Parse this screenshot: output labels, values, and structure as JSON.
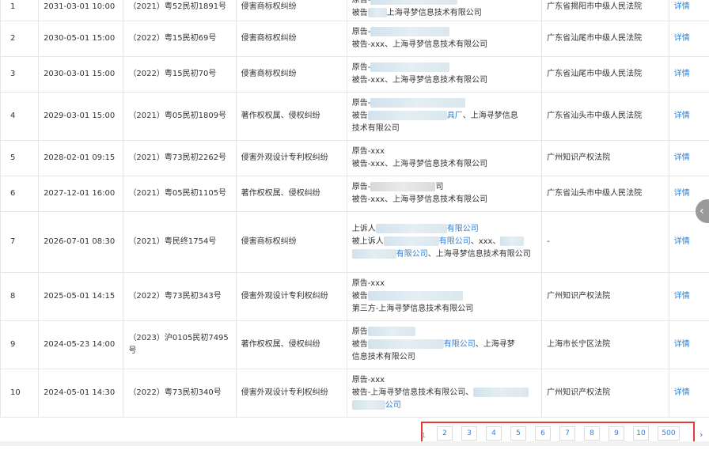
{
  "detail_label": "详情",
  "rows": [
    {
      "idx": "1",
      "date": "2031-03-01 10:00",
      "case": "（2021）粤52民初1891号",
      "cause": "侵害商标权纠纷",
      "party": [
        [
          {
            "t": "原告-"
          },
          {
            "b": 110
          }
        ],
        [
          {
            "t": "被告"
          },
          {
            "b": 24
          },
          {
            "t": "上海寻梦信息技术有限公司"
          }
        ]
      ],
      "court": "广东省揭阳市中级人民法院"
    },
    {
      "idx": "2",
      "date": "2030-05-01 15:00",
      "case": "（2022）粤15民初69号",
      "cause": "侵害商标权纠纷",
      "party": [
        [
          {
            "t": "原告-"
          },
          {
            "b": 100
          }
        ],
        [
          {
            "t": "被告-xxx、上海寻梦信息技术有限公司"
          }
        ]
      ],
      "court": "广东省汕尾市中级人民法院"
    },
    {
      "idx": "3",
      "date": "2030-03-01 15:00",
      "case": "（2022）粤15民初70号",
      "cause": "侵害商标权纠纷",
      "party": [
        [
          {
            "t": "原告-"
          },
          {
            "b": 100
          }
        ],
        [
          {
            "t": "被告-xxx、上海寻梦信息技术有限公司"
          }
        ]
      ],
      "court": "广东省汕尾市中级人民法院"
    },
    {
      "idx": "4",
      "date": "2029-03-01 15:00",
      "case": "（2021）粤05民初1809号",
      "cause": "著作权权属、侵权纠纷",
      "party": [
        [
          {
            "t": "原告-"
          },
          {
            "b": 120
          }
        ],
        [
          {
            "t": "被告"
          },
          {
            "b": 100
          },
          {
            "t": "具厂",
            "c": "blue"
          },
          {
            "t": "、上海寻梦信息"
          }
        ],
        [
          {
            "t": "技术有限公司"
          }
        ]
      ],
      "court": "广东省汕头市中级人民法院"
    },
    {
      "idx": "5",
      "date": "2028-02-01 09:15",
      "case": "（2021）粤73民初2262号",
      "cause": "侵害外观设计专利权纠纷",
      "party": [
        [
          {
            "t": "原告-xxx"
          }
        ],
        [
          {
            "t": "被告-xxx、上海寻梦信息技术有限公司"
          }
        ]
      ],
      "court": "广州知识产权法院"
    },
    {
      "idx": "6",
      "date": "2027-12-01 16:00",
      "case": "（2021）粤05民初1105号",
      "cause": "著作权权属、侵权纠纷",
      "party": [
        [
          {
            "t": "原告-"
          },
          {
            "b": 82,
            "g": 1
          },
          {
            "t": "司"
          }
        ],
        [
          {
            "t": "被告-xxx、上海寻梦信息技术有限公司"
          }
        ]
      ],
      "court": "广东省汕头市中级人民法院"
    },
    {
      "idx": "7",
      "date": "2026-07-01 08:30",
      "case": "（2021）粤民终1754号",
      "cause": "侵害商标权纠纷",
      "party": [
        [
          {
            "t": "上诉人"
          },
          {
            "b": 90
          },
          {
            "t": "有限公司",
            "c": "blue"
          }
        ],
        [
          {
            "t": "被上诉人"
          },
          {
            "b": 70
          },
          {
            "t": "有限公司",
            "c": "blue"
          },
          {
            "t": "、xxx、"
          },
          {
            "b": 30
          }
        ],
        [
          {
            "b": 56
          },
          {
            "t": "有限公司",
            "c": "blue"
          },
          {
            "t": "、上海寻梦信息技术有限公司"
          }
        ]
      ],
      "court": "-"
    },
    {
      "idx": "8",
      "date": "2025-05-01 14:15",
      "case": "（2022）粤73民初343号",
      "cause": "侵害外观设计专利权纠纷",
      "party": [
        [
          {
            "t": "原告-xxx"
          }
        ],
        [
          {
            "t": "被告"
          },
          {
            "b": 120
          }
        ],
        [
          {
            "t": "第三方-上海寻梦信息技术有限公司"
          }
        ]
      ],
      "court": "广州知识产权法院"
    },
    {
      "idx": "9",
      "date": "2024-05-23 14:00",
      "case": "（2023）沪0105民初7495号",
      "cause": "著作权权属、侵权纠纷",
      "party": [
        [
          {
            "t": "原告"
          },
          {
            "b": 60
          }
        ],
        [
          {
            "t": "被告"
          },
          {
            "b": 96
          },
          {
            "t": "有限公司",
            "c": "blue"
          },
          {
            "t": "、上海寻梦"
          }
        ],
        [
          {
            "t": "信息技术有限公司"
          }
        ]
      ],
      "court": "上海市长宁区法院"
    },
    {
      "idx": "10",
      "date": "2024-05-01 14:30",
      "case": "（2022）粤73民初340号",
      "cause": "侵害外观设计专利权纠纷",
      "party": [
        [
          {
            "t": "原告-xxx"
          }
        ],
        [
          {
            "t": "被告-上海寻梦信息技术有限公司、"
          },
          {
            "b": 70
          }
        ],
        [
          {
            "b": 42
          },
          {
            "t": "公司",
            "c": "blue"
          }
        ]
      ],
      "court": "广州知识产权法院"
    }
  ],
  "pagination": {
    "first": "1",
    "pages": [
      "2",
      "3",
      "4",
      "5",
      "6",
      "7",
      "8",
      "9",
      "10",
      "500"
    ],
    "next": "›"
  },
  "side_button": "‹"
}
